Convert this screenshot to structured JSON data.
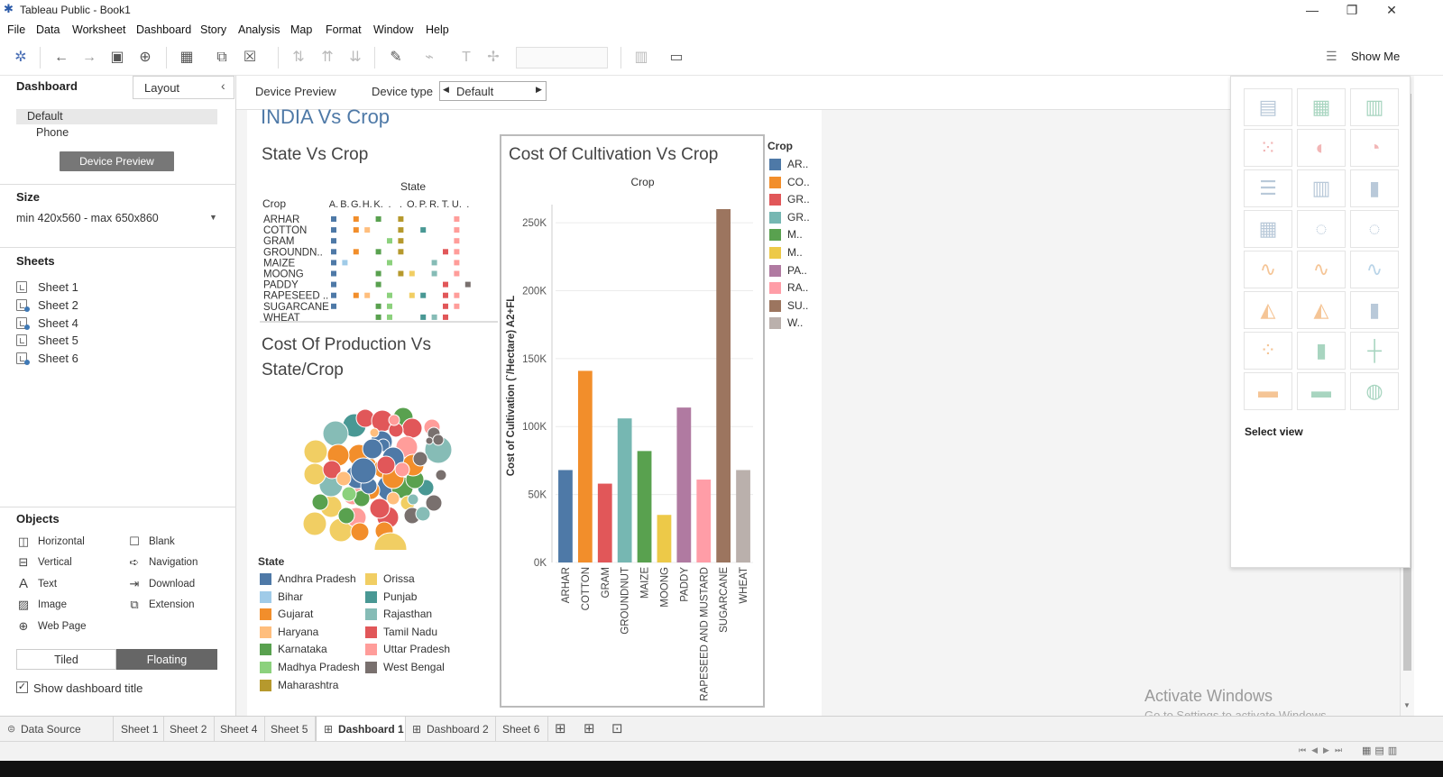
{
  "window": {
    "title": "Tableau Public - Book1",
    "min": "—",
    "restore": "❐",
    "close": "✕"
  },
  "menu": [
    "File",
    "Data",
    "Worksheet",
    "Dashboard",
    "Story",
    "Analysis",
    "Map",
    "Format",
    "Window",
    "Help"
  ],
  "toolbar": {
    "show_me": "Show Me"
  },
  "left_panel": {
    "tab_dashboard": "Dashboard",
    "tab_layout": "Layout",
    "device_default": "Default",
    "device_phone": "Phone",
    "device_preview_button": "Device Preview",
    "size_heading": "Size",
    "size_value": "min 420x560 - max 650x860",
    "sheets_heading": "Sheets",
    "sheets": [
      "Sheet 1",
      "Sheet 2",
      "Sheet 4",
      "Sheet 5",
      "Sheet 6"
    ],
    "objects_heading": "Objects",
    "objects": [
      "Horizontal",
      "Blank",
      "Vertical",
      "Navigation",
      "Text",
      "Download",
      "Image",
      "Extension",
      "Web Page"
    ],
    "tiled": "Tiled",
    "floating": "Floating",
    "show_title_label": "Show dashboard title"
  },
  "dash_header": {
    "device_preview": "Device Preview",
    "device_type_label": "Device type",
    "device_type_value": "Default"
  },
  "dashboard": {
    "title": "INDIA Vs Crop",
    "state_vs_crop": {
      "title": "State Vs Crop",
      "col_header": "State",
      "row_header": "Crop",
      "columns": [
        "A.",
        "B.",
        "G.",
        "H.",
        "K.",
        ".",
        ".",
        "O.",
        "P.",
        "R.",
        "T.",
        "U.",
        "."
      ],
      "rows": [
        "ARHAR",
        "COTTON",
        "GRAM",
        "GROUNDN..",
        "MAIZE",
        "MOONG",
        "PADDY",
        "RAPESEED ..",
        "SUGARCANE",
        "WHEAT"
      ]
    },
    "bubble": {
      "title_line1": "Cost Of Production Vs",
      "title_line2": "State/Crop"
    },
    "state_legend": {
      "title": "State",
      "items": [
        {
          "name": "Andhra Pradesh",
          "color": "#4e79a7"
        },
        {
          "name": "Bihar",
          "color": "#a0cbe8"
        },
        {
          "name": "Gujarat",
          "color": "#f28e2b"
        },
        {
          "name": "Haryana",
          "color": "#ffbe7d"
        },
        {
          "name": "Karnataka",
          "color": "#59a14f"
        },
        {
          "name": "Madhya Pradesh",
          "color": "#8cd17d"
        },
        {
          "name": "Maharashtra",
          "color": "#b6992d"
        },
        {
          "name": "Orissa",
          "color": "#f1ce63"
        },
        {
          "name": "Punjab",
          "color": "#499894"
        },
        {
          "name": "Rajasthan",
          "color": "#86bcb6"
        },
        {
          "name": "Tamil Nadu",
          "color": "#e15759"
        },
        {
          "name": "Uttar Pradesh",
          "color": "#ff9d9a"
        },
        {
          "name": "West Bengal",
          "color": "#79706e"
        }
      ]
    },
    "crop_legend": {
      "title": "Crop",
      "items": [
        {
          "name": "AR..",
          "color": "#4e79a7"
        },
        {
          "name": "CO..",
          "color": "#f28e2b"
        },
        {
          "name": "GR..",
          "color": "#e15759"
        },
        {
          "name": "GR..",
          "color": "#76b7b2"
        },
        {
          "name": "M..",
          "color": "#59a14f"
        },
        {
          "name": "M..",
          "color": "#edc948"
        },
        {
          "name": "PA..",
          "color": "#b07aa1"
        },
        {
          "name": "RA..",
          "color": "#ff9da7"
        },
        {
          "name": "SU..",
          "color": "#9c755f"
        },
        {
          "name": "W..",
          "color": "#bab0ac"
        }
      ]
    }
  },
  "chart_data": {
    "type": "bar",
    "title": "Cost Of Cultivation Vs Crop",
    "xlabel": "Crop",
    "ylabel": "Cost of Cultivation (`/Hectare) A2+FL",
    "ylim": [
      0,
      260000
    ],
    "yticks": [
      "0K",
      "50K",
      "100K",
      "150K",
      "200K",
      "250K"
    ],
    "ytick_values": [
      0,
      50000,
      100000,
      150000,
      200000,
      250000
    ],
    "categories": [
      "ARHAR",
      "COTTON",
      "GRAM",
      "GROUNDNUT",
      "MAIZE",
      "MOONG",
      "PADDY",
      "RAPESEED AND MUSTARD",
      "SUGARCANE",
      "WHEAT"
    ],
    "values": [
      68000,
      141000,
      58000,
      106000,
      82000,
      35000,
      114000,
      61000,
      260000,
      68000
    ],
    "colors": [
      "#4e79a7",
      "#f28e2b",
      "#e15759",
      "#76b7b2",
      "#59a14f",
      "#edc948",
      "#b07aa1",
      "#ff9da7",
      "#9c755f",
      "#bab0ac"
    ]
  },
  "show_me": {
    "select_view": "Select view"
  },
  "bottom_tabs": {
    "data_source": "Data Source",
    "tabs": [
      "Sheet 1",
      "Sheet 2",
      "Sheet 4",
      "Sheet 5",
      "Dashboard 1",
      "Dashboard 2",
      "Sheet 6"
    ]
  },
  "watermark": {
    "line1": "Activate Windows",
    "line2": "Go to Settings to activate Windows."
  }
}
